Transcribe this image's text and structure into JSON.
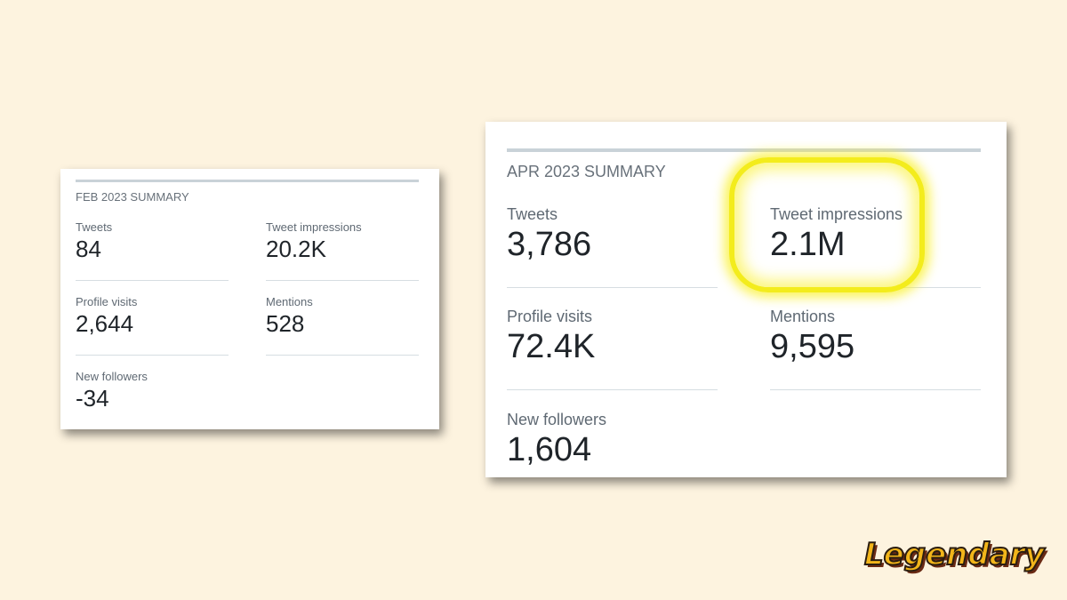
{
  "feb": {
    "title": "FEB 2023 SUMMARY",
    "stats": [
      {
        "label": "Tweets",
        "value": "84"
      },
      {
        "label": "Tweet impressions",
        "value": "20.2K"
      },
      {
        "label": "Profile visits",
        "value": "2,644"
      },
      {
        "label": "Mentions",
        "value": "528"
      },
      {
        "label": "New followers",
        "value": "-34"
      }
    ]
  },
  "apr": {
    "title": "APR 2023 SUMMARY",
    "stats": [
      {
        "label": "Tweets",
        "value": "3,786"
      },
      {
        "label": "Tweet impressions",
        "value": "2.1M"
      },
      {
        "label": "Profile visits",
        "value": "72.4K"
      },
      {
        "label": "Mentions",
        "value": "9,595"
      },
      {
        "label": "New followers",
        "value": "1,604"
      }
    ]
  },
  "highlight_color": "#f3ec1c",
  "background_color": "#fdf3df",
  "logo": {
    "text": "Legendary"
  }
}
